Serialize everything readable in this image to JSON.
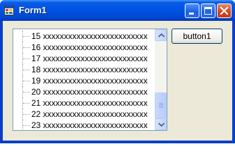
{
  "window": {
    "title": "Form1",
    "icon": "app-window-icon",
    "controls": [
      "minimize-icon",
      "maximize-icon",
      "close-icon"
    ],
    "title_color": "#ffffff",
    "titlebar_color": "#0054e3",
    "client_bg": "#ece9d8"
  },
  "tree": {
    "items": [
      {
        "label": "15 xxxxxxxxxxxxxxxxxxxxxxxxx"
      },
      {
        "label": "16 xxxxxxxxxxxxxxxxxxxxxxxxx"
      },
      {
        "label": "17 xxxxxxxxxxxxxxxxxxxxxxxxx"
      },
      {
        "label": "18 xxxxxxxxxxxxxxxxxxxxxxxxx"
      },
      {
        "label": "19 xxxxxxxxxxxxxxxxxxxxxxxxx"
      },
      {
        "label": "20 xxxxxxxxxxxxxxxxxxxxxxxxx"
      },
      {
        "label": "21 xxxxxxxxxxxxxxxxxxxxxxxxx"
      },
      {
        "label": "22 xxxxxxxxxxxxxxxxxxxxxxxxx"
      },
      {
        "label": "23 xxxxxxxxxxxxxxxxxxxxxxxxx"
      }
    ],
    "scroll": {
      "up_icon": "arrow-up-icon",
      "down_icon": "arrow-down-icon"
    }
  },
  "button1": {
    "label": "button1"
  }
}
